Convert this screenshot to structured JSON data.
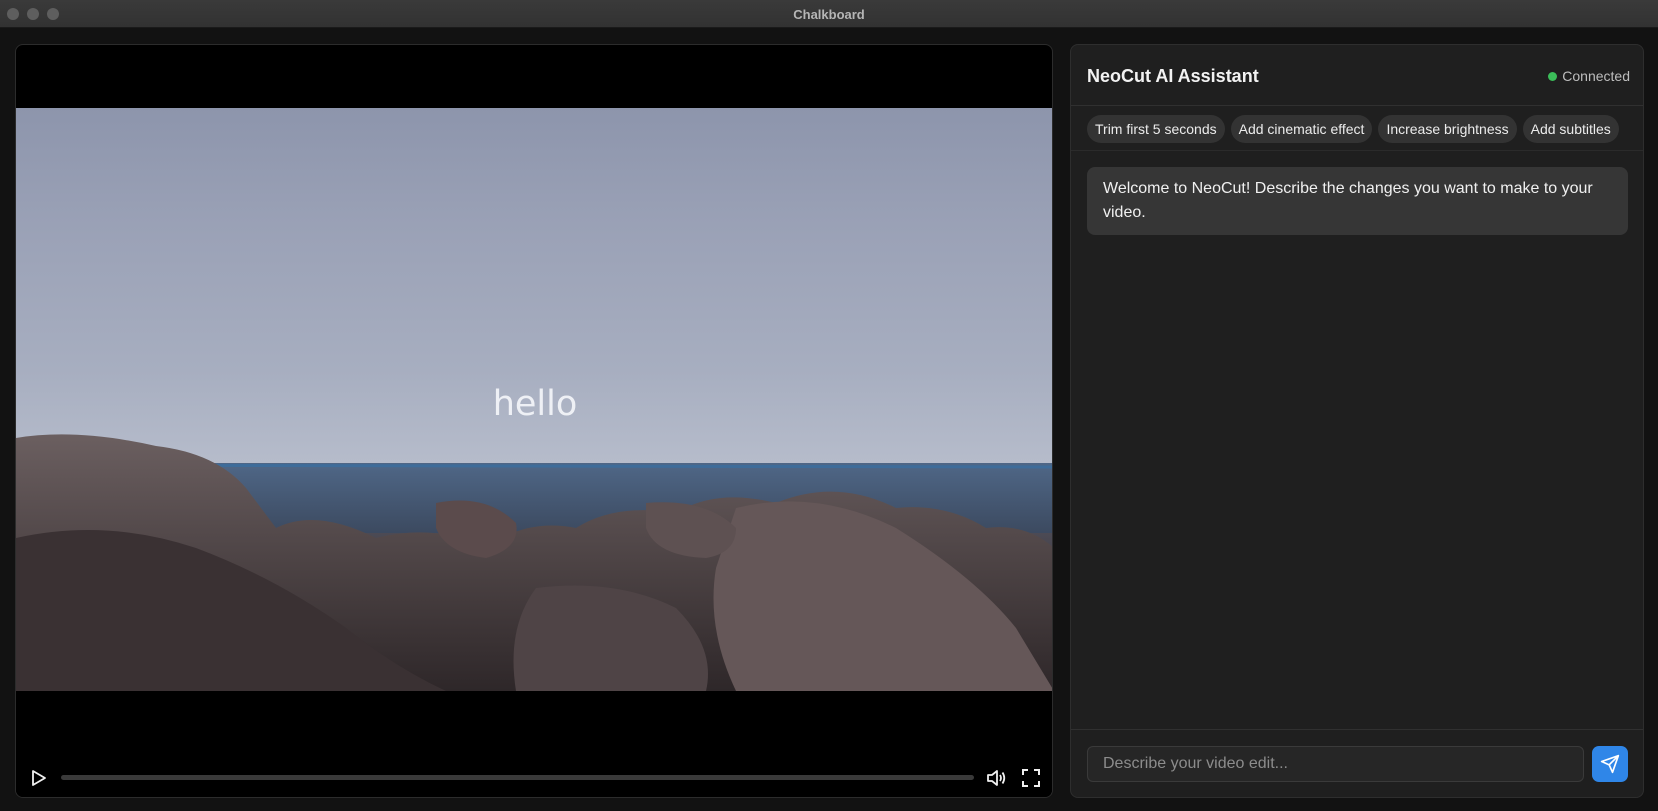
{
  "window": {
    "title": "Chalkboard"
  },
  "player": {
    "overlay_text": "hello",
    "progress": 0,
    "icons": {
      "play": "play-icon",
      "volume": "volume-icon",
      "fullscreen": "fullscreen-icon"
    }
  },
  "assistant": {
    "title": "NeoCut AI Assistant",
    "status": "Connected",
    "status_color": "#3bbd59",
    "suggestions": [
      "Trim first 5 seconds",
      "Add cinematic effect",
      "Increase brightness",
      "Add subtitles"
    ],
    "messages": [
      {
        "role": "assistant",
        "text": "Welcome to NeoCut! Describe the changes you want to make to your video."
      }
    ],
    "input": {
      "placeholder": "Describe your video edit...",
      "value": ""
    },
    "send_icon": "send-icon",
    "accent": "#2f86e8"
  }
}
